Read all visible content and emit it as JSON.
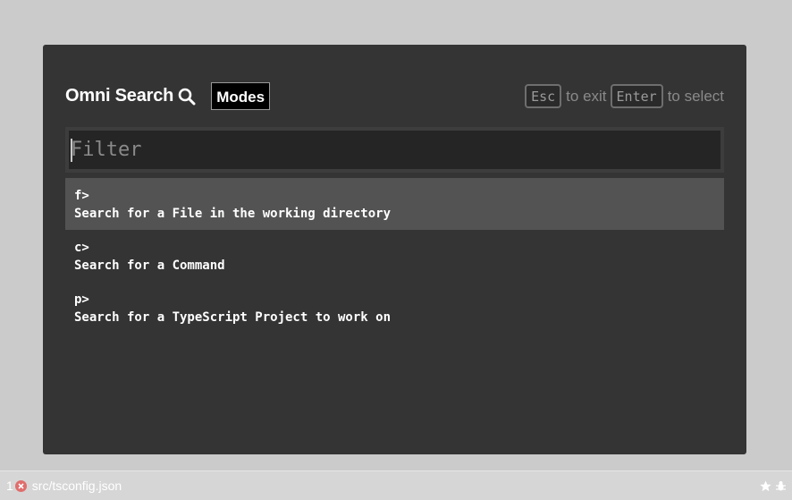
{
  "dialog": {
    "title": "Omni Search",
    "title_icon": "search-icon",
    "modes_label": "Modes",
    "hints": {
      "esc_key": "Esc",
      "esc_text": "to exit",
      "enter_key": "Enter",
      "enter_text": "to select"
    },
    "filter": {
      "placeholder": "Filter",
      "value": ""
    },
    "items": [
      {
        "prefix": "f>",
        "description": "Search for a File in the working directory",
        "selected": true
      },
      {
        "prefix": "c>",
        "description": "Search for a Command",
        "selected": false
      },
      {
        "prefix": "p>",
        "description": "Search for a TypeScript Project to work on",
        "selected": false
      }
    ]
  },
  "statusbar": {
    "error_count": "1",
    "error_icon": "error-circle-icon",
    "file_path": "src/tsconfig.json",
    "right_icons": [
      "star-icon",
      "bug-icon"
    ]
  },
  "colors": {
    "page_bg": "#cbcbcb",
    "dialog_bg": "#333433",
    "selected_item_bg": "#525352",
    "filter_bg": "#252525",
    "error_red": "#e06d6d"
  }
}
